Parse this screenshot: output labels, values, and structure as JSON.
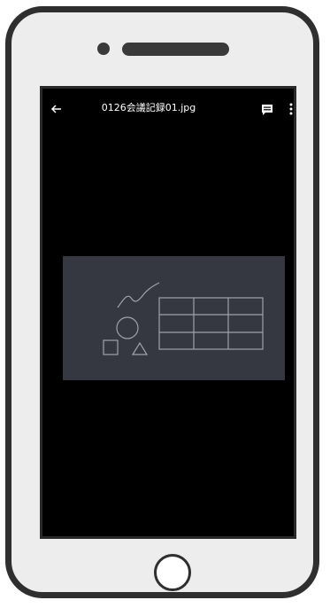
{
  "viewer": {
    "file_name": "0126会議記録01.jpg",
    "icons": {
      "back": "arrow-left-icon",
      "comment": "comment-icon",
      "more": "more-vert-icon",
      "camera": "camera-dot-icon",
      "speaker": "speaker-icon",
      "home": "home-button-icon"
    }
  },
  "colors": {
    "frame": "#2f2f2f",
    "bezel": "#ededed",
    "screen": "#000000",
    "image_background": "#353840",
    "image_lines": "#9ea2ab"
  }
}
